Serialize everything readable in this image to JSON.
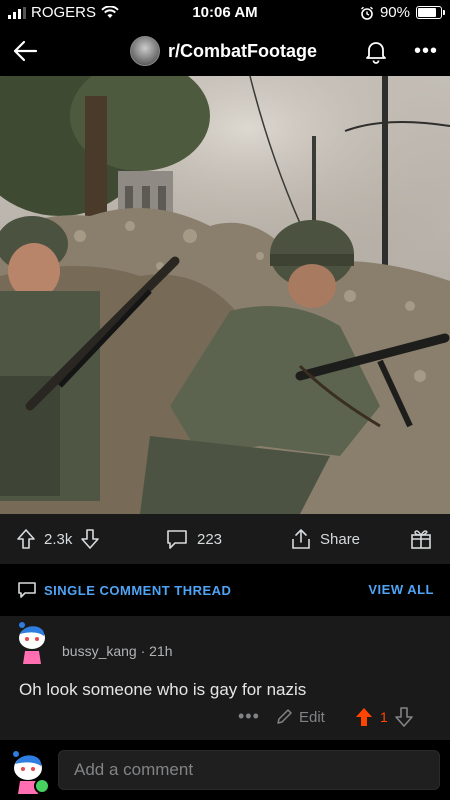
{
  "status": {
    "carrier": "ROGERS",
    "time": "10:06 AM",
    "battery": "90%"
  },
  "header": {
    "subreddit": "r/CombatFootage"
  },
  "post": {
    "image_alt": "Colorized photo of soldiers in helmets holding rifles behind a rubble barricade",
    "upvotes": "2.3k",
    "comments": "223",
    "share_label": "Share"
  },
  "thread": {
    "label": "SINGLE COMMENT THREAD",
    "view_all": "VIEW ALL"
  },
  "comment": {
    "username": "bussy_kang",
    "age": "21h",
    "text": "Oh look someone who is gay for nazis",
    "edit_label": "Edit",
    "score": "1"
  },
  "composer": {
    "placeholder": "Add a comment"
  },
  "colors": {
    "accent_blue": "#4fa4f6",
    "upvote_orange": "#ff4500",
    "online_green": "#46d160"
  }
}
